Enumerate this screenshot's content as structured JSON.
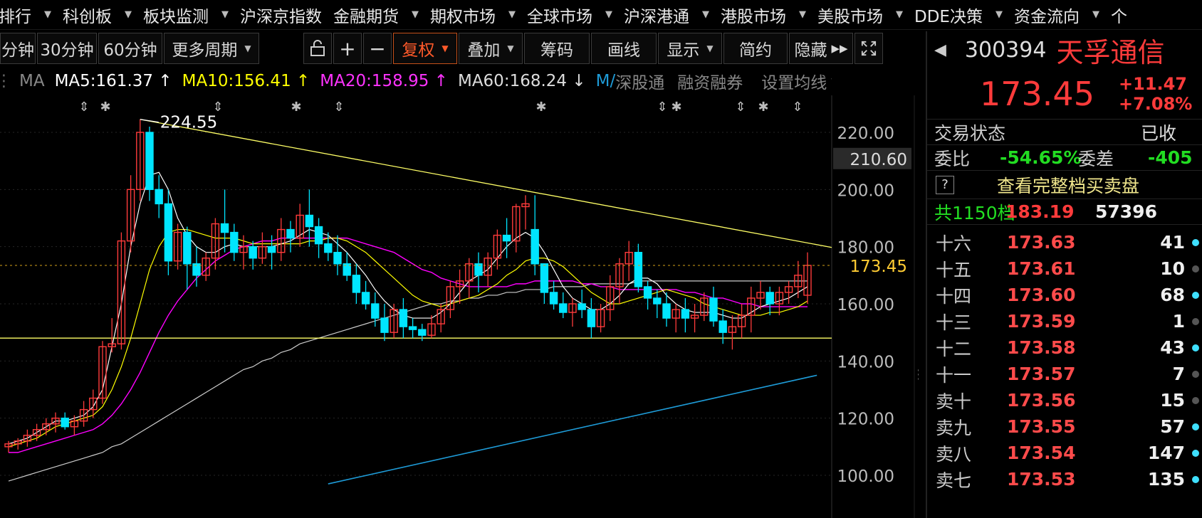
{
  "nav": [
    {
      "label": "排行",
      "caret": true
    },
    {
      "label": "科创板",
      "caret": true
    },
    {
      "label": "板块监测",
      "caret": true
    },
    {
      "label": "沪深京指数",
      "caret": false
    },
    {
      "label": "金融期货",
      "caret": true
    },
    {
      "label": "期权市场",
      "caret": true
    },
    {
      "label": "全球市场",
      "caret": true
    },
    {
      "label": "沪深港通",
      "caret": true
    },
    {
      "label": "港股市场",
      "caret": true
    },
    {
      "label": "美股市场",
      "caret": true
    },
    {
      "label": "DDE决策",
      "caret": true
    },
    {
      "label": "资金流向",
      "caret": true
    },
    {
      "label": "个",
      "caret": false
    }
  ],
  "toolbar": {
    "min5": "分钟",
    "min30": "30分钟",
    "min60": "60分钟",
    "more": "更多周期",
    "fuquan": "复权",
    "diejia": "叠加",
    "chouma": "筹码",
    "huaxian": "画线",
    "xianshi": "显示",
    "jianyue": "简约",
    "yincang": "隐藏"
  },
  "ma": {
    "label": "MA",
    "ma5": "MA5:161.37",
    "ma10": "MA10:156.41",
    "ma20": "MA20:158.95",
    "ma60": "MA60:168.24",
    "ma_more": "M/",
    "arrow_up": "↑",
    "arrow_down": "↓",
    "sgt": "深股通",
    "rzrq": "融资融券",
    "szjx": "设置均线"
  },
  "colors": {
    "up": "#ff3b3b",
    "down": "#00e5ff",
    "ma5": "#ffffff",
    "ma10": "#ffff00",
    "ma20": "#ff00ff",
    "ma60": "#cccccc",
    "ma_long": "#1e9bd7",
    "trend": "#ffff66",
    "accent": "#ff5a2a"
  },
  "chart": {
    "peak_label": "224.55",
    "y_ticks": [
      "220.00",
      "200.00",
      "180.00",
      "160.00",
      "140.00",
      "120.00",
      "100.00"
    ],
    "y_values": [
      220,
      200,
      180,
      160,
      140,
      120,
      100
    ],
    "price_tag": "173.45",
    "hover_tag": "210.60",
    "last_price": 173.45,
    "hover_price": 210.6,
    "candles": [
      [
        110,
        112,
        108,
        111
      ],
      [
        111,
        113,
        109,
        112
      ],
      [
        112,
        116,
        110,
        114
      ],
      [
        114,
        118,
        112,
        116
      ],
      [
        116,
        120,
        114,
        118
      ],
      [
        118,
        122,
        115,
        120
      ],
      [
        120,
        122,
        116,
        117
      ],
      [
        117,
        121,
        114,
        119
      ],
      [
        119,
        126,
        117,
        123
      ],
      [
        123,
        130,
        120,
        127
      ],
      [
        127,
        147,
        125,
        145
      ],
      [
        145,
        155,
        143,
        146
      ],
      [
        146,
        185,
        144,
        182
      ],
      [
        182,
        205,
        178,
        200
      ],
      [
        200,
        224.55,
        196,
        220
      ],
      [
        220,
        222,
        196,
        200
      ],
      [
        200,
        205,
        190,
        195
      ],
      [
        195,
        200,
        170,
        175
      ],
      [
        175,
        188,
        172,
        185
      ],
      [
        185,
        187,
        165,
        174
      ],
      [
        174,
        180,
        166,
        170
      ],
      [
        170,
        178,
        168,
        176
      ],
      [
        176,
        190,
        172,
        188
      ],
      [
        188,
        200,
        178,
        185
      ],
      [
        185,
        188,
        175,
        178
      ],
      [
        178,
        184,
        172,
        180
      ],
      [
        180,
        182,
        172,
        176
      ],
      [
        176,
        185,
        174,
        180
      ],
      [
        180,
        184,
        172,
        178
      ],
      [
        178,
        190,
        175,
        186
      ],
      [
        186,
        189,
        178,
        183
      ],
      [
        183,
        195,
        180,
        191
      ],
      [
        191,
        200,
        180,
        187
      ],
      [
        187,
        190,
        176,
        181
      ],
      [
        181,
        185,
        175,
        178
      ],
      [
        178,
        184,
        170,
        174
      ],
      [
        174,
        178,
        168,
        170
      ],
      [
        170,
        174,
        160,
        164
      ],
      [
        164,
        168,
        158,
        160
      ],
      [
        160,
        164,
        152,
        155
      ],
      [
        155,
        160,
        147,
        150
      ],
      [
        150,
        160,
        148,
        158
      ],
      [
        158,
        162,
        148,
        152
      ],
      [
        152,
        155,
        148,
        151
      ],
      [
        151,
        153,
        147,
        149
      ],
      [
        149,
        156,
        148,
        153
      ],
      [
        153,
        160,
        150,
        158
      ],
      [
        158,
        168,
        155,
        166
      ],
      [
        166,
        172,
        160,
        168
      ],
      [
        168,
        176,
        162,
        174
      ],
      [
        174,
        178,
        164,
        170
      ],
      [
        170,
        178,
        166,
        176
      ],
      [
        176,
        186,
        172,
        184
      ],
      [
        184,
        190,
        176,
        182
      ],
      [
        182,
        195,
        178,
        194
      ],
      [
        194,
        198,
        186,
        195
      ],
      [
        186,
        198,
        170,
        174
      ],
      [
        174,
        172,
        160,
        164
      ],
      [
        164,
        168,
        158,
        160
      ],
      [
        160,
        164,
        155,
        157
      ],
      [
        157,
        162,
        152,
        160
      ],
      [
        160,
        165,
        155,
        158
      ],
      [
        158,
        162,
        148,
        152
      ],
      [
        152,
        160,
        150,
        158
      ],
      [
        158,
        170,
        154,
        166
      ],
      [
        166,
        176,
        160,
        174
      ],
      [
        174,
        182,
        168,
        178
      ],
      [
        178,
        181,
        164,
        166
      ],
      [
        166,
        168,
        158,
        162
      ],
      [
        162,
        165,
        155,
        160
      ],
      [
        160,
        164,
        152,
        155
      ],
      [
        155,
        160,
        150,
        158
      ],
      [
        158,
        162,
        150,
        155
      ],
      [
        155,
        160,
        150,
        156
      ],
      [
        156,
        164,
        154,
        162
      ],
      [
        162,
        166,
        152,
        154
      ],
      [
        154,
        158,
        146,
        150
      ],
      [
        150,
        156,
        144,
        152
      ],
      [
        152,
        160,
        148,
        156
      ],
      [
        156,
        166,
        150,
        162
      ],
      [
        162,
        168,
        158,
        164
      ],
      [
        164,
        166,
        156,
        160
      ],
      [
        160,
        166,
        156,
        164
      ],
      [
        164,
        168,
        160,
        166
      ],
      [
        166,
        175,
        162,
        170
      ],
      [
        163,
        178,
        160,
        173.45
      ]
    ],
    "trend_line": [
      [
        14,
        224.55
      ],
      [
        86,
        180
      ]
    ],
    "support": 148,
    "ma5": [
      111,
      112,
      113,
      115,
      117,
      119,
      119,
      120,
      121,
      124,
      130,
      145,
      160,
      180,
      195,
      205,
      206,
      200,
      190,
      184,
      180,
      178,
      178,
      180,
      181,
      180,
      180,
      180,
      180,
      181,
      182,
      184,
      186,
      185,
      184,
      181,
      178,
      174,
      170,
      165,
      161,
      158,
      156,
      155,
      155,
      155,
      157,
      160,
      164,
      168,
      170,
      172,
      176,
      180,
      183,
      185,
      183,
      178,
      172,
      166,
      162,
      160,
      158,
      158,
      160,
      163,
      167,
      169,
      169,
      167,
      163,
      160,
      158,
      157,
      157,
      157,
      156,
      155,
      155,
      157,
      159,
      160,
      161,
      162,
      164,
      166
    ],
    "ma10": [
      110,
      111,
      112,
      113,
      115,
      117,
      118,
      119,
      120,
      121,
      124,
      130,
      138,
      148,
      160,
      172,
      180,
      185,
      186,
      186,
      185,
      184,
      183,
      183,
      183,
      182,
      181,
      181,
      181,
      181,
      181,
      181,
      182,
      182,
      183,
      183,
      182,
      180,
      178,
      175,
      172,
      169,
      166,
      163,
      161,
      160,
      159,
      160,
      161,
      162,
      163,
      165,
      167,
      170,
      172,
      175,
      176,
      176,
      175,
      173,
      170,
      167,
      164,
      162,
      160,
      160,
      161,
      162,
      163,
      164,
      165,
      164,
      163,
      162,
      160,
      159,
      158,
      157,
      156,
      156,
      156,
      157,
      157,
      158,
      159,
      161
    ],
    "ma20": [
      108,
      108,
      109,
      110,
      111,
      112,
      113,
      114,
      115,
      116,
      118,
      121,
      125,
      130,
      136,
      143,
      150,
      156,
      161,
      165,
      169,
      172,
      175,
      177,
      179,
      180,
      181,
      182,
      182,
      183,
      183,
      183,
      183,
      183,
      183,
      183,
      183,
      182,
      181,
      180,
      179,
      178,
      176,
      174,
      172,
      171,
      169,
      168,
      167,
      166,
      166,
      166,
      166,
      166,
      167,
      167,
      168,
      168,
      168,
      168,
      168,
      167,
      167,
      166,
      166,
      165,
      165,
      165,
      165,
      165,
      165,
      165,
      164,
      164,
      163,
      162,
      162,
      161,
      160,
      160,
      159,
      159,
      159,
      159,
      159,
      159
    ],
    "ma60": [
      98,
      99,
      100,
      101,
      102,
      103,
      104,
      105,
      106,
      107,
      108,
      110,
      111,
      113,
      115,
      117,
      119,
      121,
      123,
      125,
      127,
      129,
      131,
      133,
      135,
      137,
      138,
      140,
      141,
      143,
      144,
      146,
      147,
      148,
      149,
      150,
      151,
      152,
      153,
      154,
      155,
      156,
      157,
      158,
      159,
      160,
      160,
      161,
      161,
      162,
      162,
      163,
      163,
      164,
      164,
      165,
      165,
      165,
      166,
      166,
      166,
      166,
      167,
      167,
      167,
      167,
      167,
      168,
      168,
      168,
      168,
      168,
      168,
      168,
      168,
      168,
      168,
      168,
      168,
      168,
      168,
      168,
      168,
      168,
      168,
      168
    ],
    "ma_long_start": [
      34,
      97
    ],
    "ma_long_end": [
      86,
      135
    ]
  },
  "right": {
    "code": "300394",
    "name": "天孚通信",
    "price": "173.45",
    "change": "+11.47",
    "pct": "+7.08%",
    "status_label": "交易状态",
    "status_value": "已收",
    "weibi_label": "委比",
    "weibi_value": "-54.65%",
    "weicha_label": "委差",
    "weicha_value": "-405",
    "help": "?",
    "full_book": "查看完整档买卖盘",
    "total_label": "共1150档",
    "total_price": "183.19",
    "total_vol": "57396",
    "book": [
      {
        "label": "十六",
        "price": "173.63",
        "vol": "41",
        "dot": "#3fe0ff"
      },
      {
        "label": "十五",
        "price": "173.61",
        "vol": "10",
        "dot": "#555555"
      },
      {
        "label": "十四",
        "price": "173.60",
        "vol": "68",
        "dot": "#3fe0ff"
      },
      {
        "label": "十三",
        "price": "173.59",
        "vol": "1",
        "dot": "#555555"
      },
      {
        "label": "十二",
        "price": "173.58",
        "vol": "43",
        "dot": "#3fe0ff"
      },
      {
        "label": "十一",
        "price": "173.57",
        "vol": "7",
        "dot": "#555555"
      },
      {
        "label": "卖十",
        "price": "173.56",
        "vol": "15",
        "dot": "#555555"
      },
      {
        "label": "卖九",
        "price": "173.55",
        "vol": "57",
        "dot": "#3fe0ff"
      },
      {
        "label": "卖八",
        "price": "173.54",
        "vol": "147",
        "dot": "#3fe0ff"
      },
      {
        "label": "卖七",
        "price": "173.53",
        "vol": "135",
        "dot": "#3fe0ff"
      }
    ]
  }
}
